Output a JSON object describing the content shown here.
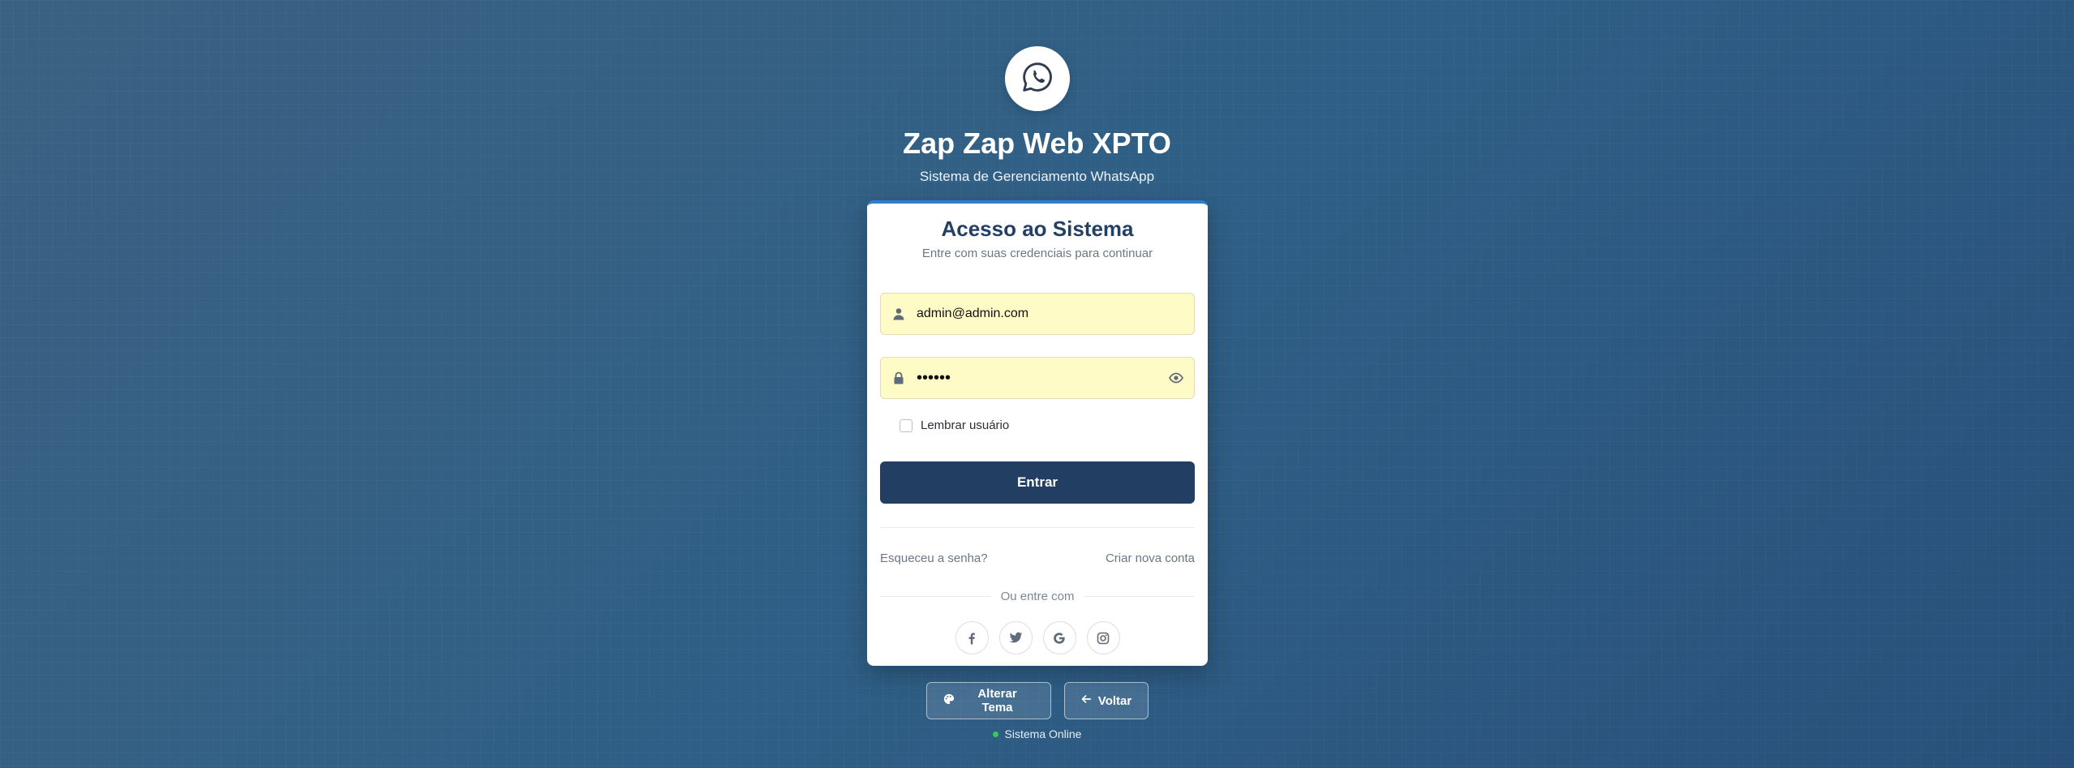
{
  "brand": {
    "title": "Zap Zap Web XPTO",
    "subtitle": "Sistema de Gerenciamento WhatsApp",
    "logo_icon": "whatsapp-icon"
  },
  "card": {
    "title": "Acesso ao Sistema",
    "subtitle": "Entre com suas credenciais para continuar",
    "email": {
      "value": "admin@admin.com",
      "icon": "user-icon"
    },
    "password": {
      "value": "123456",
      "icon": "lock-icon",
      "toggle_icon": "eye-icon"
    },
    "remember_label": "Lembrar usuário",
    "remember_checked": false,
    "submit_label": "Entrar",
    "forgot_label": "Esqueceu a senha?",
    "signup_label": "Criar nova conta",
    "or_label": "Ou entre com",
    "socials": [
      "facebook-icon",
      "twitter-icon",
      "google-icon",
      "instagram-icon"
    ]
  },
  "footer": {
    "theme_label": "Alterar Tema",
    "back_label": "Voltar",
    "status_label": "Sistema Online",
    "status_color": "#3fc65b"
  },
  "colors": {
    "primary": "#223f63",
    "accent": "#2f7fd1",
    "autofill": "#fefbc6"
  }
}
